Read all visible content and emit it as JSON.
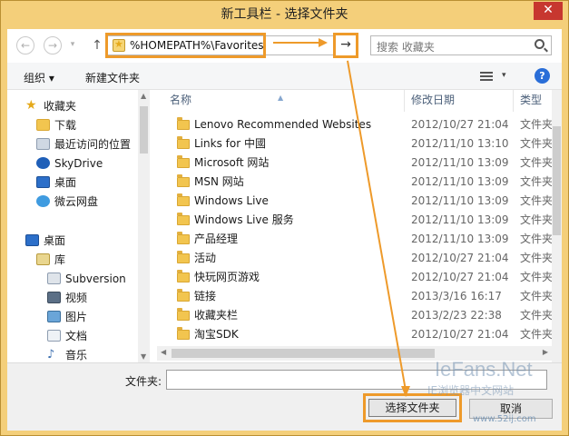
{
  "window": {
    "title": "新工具栏 - 选择文件夹",
    "close_glyph": "✕"
  },
  "address_bar": {
    "path": "%HOMEPATH%\\Favorites",
    "back_glyph": "←",
    "forward_glyph": "→",
    "up_glyph": "↑",
    "dropdown_glyph": "▾",
    "go_glyph": "→"
  },
  "search": {
    "placeholder": "搜索 收藏夹"
  },
  "toolbar": {
    "organize": "组织 ▾",
    "new_folder": "新建文件夹",
    "view_dropdown": "▾",
    "help": "?"
  },
  "navigation": {
    "items": [
      {
        "label": "收藏夹",
        "icon": "star-icon"
      },
      {
        "label": "下载",
        "icon": "download-folder-icon"
      },
      {
        "label": "最近访问的位置",
        "icon": "recent-places-icon"
      },
      {
        "label": "SkyDrive",
        "icon": "skydrive-icon"
      },
      {
        "label": "桌面",
        "icon": "desktop-icon"
      },
      {
        "label": "微云网盘",
        "icon": "cloud-drive-icon"
      },
      {
        "label": "桌面",
        "icon": "desktop-icon"
      },
      {
        "label": "库",
        "icon": "library-icon"
      },
      {
        "label": "Subversion",
        "icon": "library-folder-icon"
      },
      {
        "label": "视频",
        "icon": "video-icon"
      },
      {
        "label": "图片",
        "icon": "pictures-icon"
      },
      {
        "label": "文档",
        "icon": "documents-icon"
      },
      {
        "label": "音乐",
        "icon": "music-icon"
      }
    ]
  },
  "columns": {
    "name": "名称",
    "modified": "修改日期",
    "type": "类型"
  },
  "files": [
    {
      "name": "Lenovo Recommended Websites",
      "date": "2012/10/27 21:04",
      "type": "文件夹"
    },
    {
      "name": "Links for 中國",
      "date": "2012/11/10 13:10",
      "type": "文件夹"
    },
    {
      "name": "Microsoft 网站",
      "date": "2012/11/10 13:09",
      "type": "文件夹"
    },
    {
      "name": "MSN 网站",
      "date": "2012/11/10 13:09",
      "type": "文件夹"
    },
    {
      "name": "Windows Live",
      "date": "2012/11/10 13:09",
      "type": "文件夹"
    },
    {
      "name": "Windows Live 服务",
      "date": "2012/11/10 13:09",
      "type": "文件夹"
    },
    {
      "name": "产品经理",
      "date": "2012/11/10 13:09",
      "type": "文件夹"
    },
    {
      "name": "活动",
      "date": "2012/10/27 21:04",
      "type": "文件夹"
    },
    {
      "name": "快玩网页游戏",
      "date": "2012/10/27 21:04",
      "type": "文件夹"
    },
    {
      "name": "链接",
      "date": "2013/3/16 16:17",
      "type": "文件夹"
    },
    {
      "name": "收藏夹栏",
      "date": "2013/2/23 22:38",
      "type": "文件夹"
    },
    {
      "name": "淘宝SDK",
      "date": "2012/10/27 21:04",
      "type": "文件夹"
    }
  ],
  "bottom": {
    "folder_label": "文件夹:",
    "folder_value": "",
    "select_button": "选择文件夹",
    "cancel_button": "取消"
  },
  "watermark": {
    "line1": "IeFans.Net",
    "line2": "IE浏览器中文网站",
    "line3": "www.52ij.com"
  },
  "colors": {
    "highlight": "#ee9a2a",
    "frame": "#f4cf7a",
    "close": "#c7372f"
  }
}
